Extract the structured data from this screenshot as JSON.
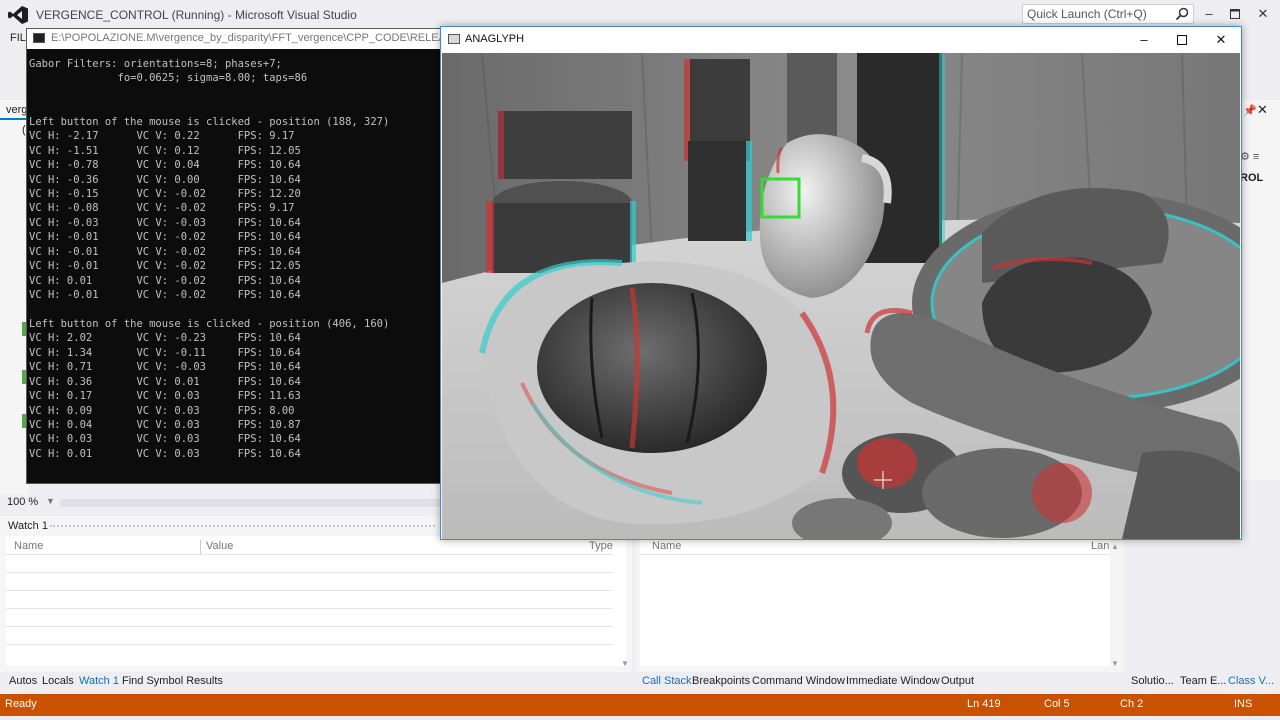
{
  "vs": {
    "title": "VERGENCE_CONTROL (Running) - Microsoft Visual Studio",
    "quick_launch_placeholder": "Quick Launch (Ctrl+Q)",
    "menu_file": "FILE",
    "doc_tab_label": "verg",
    "zoom_level": "100 %",
    "right_panel_text": "ROL"
  },
  "console": {
    "title": "E:\\POPOLAZIONE.M\\vergence_by_disparity\\FFT_vergence\\CPP_CODE\\RELEASES\\RELEASE",
    "lines": [
      "Gabor Filters: orientations=8; phases+7;",
      "              fo=0.0625; sigma=8.00; taps=86",
      "",
      "",
      "Left button of the mouse is clicked - position (188, 327)",
      "VC H: -2.17      VC V: 0.22      FPS: 9.17",
      "VC H: -1.51      VC V: 0.12      FPS: 12.05",
      "VC H: -0.78      VC V: 0.04      FPS: 10.64",
      "VC H: -0.36      VC V: 0.00      FPS: 10.64",
      "VC H: -0.15      VC V: -0.02     FPS: 12.20",
      "VC H: -0.08      VC V: -0.02     FPS: 9.17",
      "VC H: -0.03      VC V: -0.03     FPS: 10.64",
      "VC H: -0.01      VC V: -0.02     FPS: 10.64",
      "VC H: -0.01      VC V: -0.02     FPS: 10.64",
      "VC H: -0.01      VC V: -0.02     FPS: 12.05",
      "VC H: 0.01       VC V: -0.02     FPS: 10.64",
      "VC H: -0.01      VC V: -0.02     FPS: 10.64",
      "",
      "Left button of the mouse is clicked - position (406, 160)",
      "VC H: 2.02       VC V: -0.23     FPS: 10.64",
      "VC H: 1.34       VC V: -0.11     FPS: 10.64",
      "VC H: 0.71       VC V: -0.03     FPS: 10.64",
      "VC H: 0.36       VC V: 0.01      FPS: 10.64",
      "VC H: 0.17       VC V: 0.03      FPS: 11.63",
      "VC H: 0.09       VC V: 0.03      FPS: 8.00",
      "VC H: 0.04       VC V: 0.03      FPS: 10.87",
      "VC H: 0.03       VC V: 0.03      FPS: 10.64",
      "VC H: 0.01       VC V: 0.03      FPS: 10.64"
    ]
  },
  "anaglyph": {
    "title": "ANAGLYPH"
  },
  "watch": {
    "title": "Watch 1",
    "col_name": "Name",
    "col_value": "Value",
    "col_type": "Type"
  },
  "callstack": {
    "col_name": "Name",
    "col_lang": "Lan"
  },
  "bottom_tabs": {
    "left": [
      "Autos",
      "Locals",
      "Watch 1",
      "Find Symbol Results"
    ],
    "middle": [
      "Call Stack",
      "Breakpoints",
      "Command Window",
      "Immediate Window",
      "Output"
    ],
    "right": [
      "Solutio...",
      "Team E...",
      "Class V..."
    ]
  },
  "status": {
    "ready": "Ready",
    "ln": "Ln 419",
    "col": "Col 5",
    "ch": "Ch 2",
    "ins": "INS"
  },
  "colors": {
    "status_bar": "#ca5100",
    "accent": "#007acc",
    "active_tab": "#0e70c0",
    "selection_box": "#33dd33"
  },
  "icons": {
    "vs_logo": "visual-studio-logo-icon",
    "search": "search-icon",
    "minimize": "minimize-icon",
    "maximize": "maximize-icon",
    "close": "close-icon",
    "pin": "pin-icon",
    "console": "console-app-icon",
    "anaglyph": "window-app-icon",
    "crosshair": "crosshair-cursor-icon"
  }
}
